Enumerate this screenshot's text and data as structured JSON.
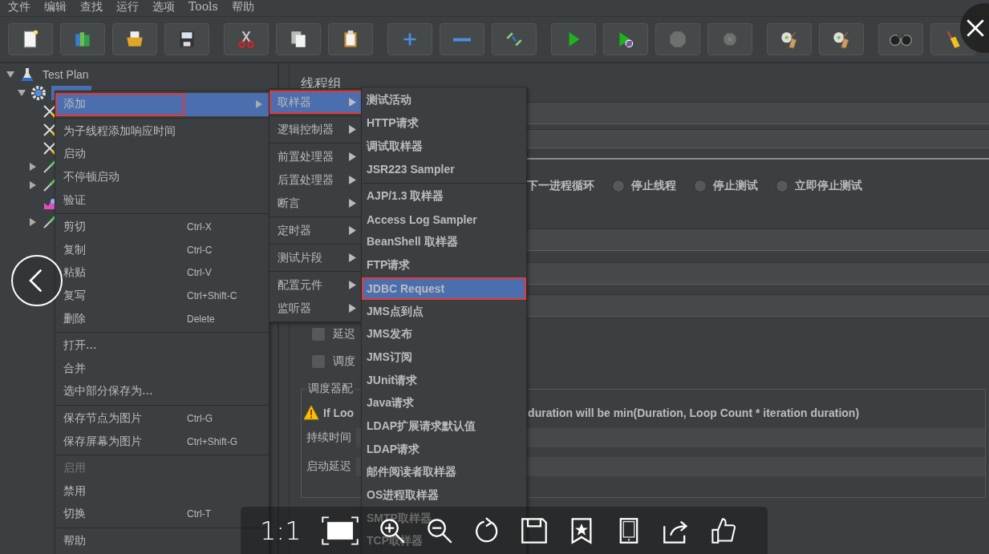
{
  "menu_bar": [
    "文件",
    "编辑",
    "查找",
    "运行",
    "选项",
    "Tools",
    "帮助"
  ],
  "toolbar": [
    [
      {
        "kind": "new",
        "disabled": false
      },
      {
        "kind": "templates",
        "disabled": false
      },
      {
        "kind": "open",
        "disabled": false
      },
      {
        "kind": "save",
        "disabled": false
      }
    ],
    [
      {
        "kind": "cut",
        "disabled": false
      },
      {
        "kind": "copy",
        "disabled": false
      },
      {
        "kind": "paste",
        "disabled": false
      }
    ],
    [
      {
        "kind": "expand",
        "disabled": false
      },
      {
        "kind": "collapse",
        "disabled": false
      },
      {
        "kind": "toggle",
        "disabled": false
      }
    ],
    [
      {
        "kind": "start",
        "disabled": false
      },
      {
        "kind": "start-no-timers",
        "disabled": false
      },
      {
        "kind": "stop",
        "disabled": true
      },
      {
        "kind": "shutdown",
        "disabled": true
      }
    ],
    [
      {
        "kind": "clear",
        "disabled": false
      },
      {
        "kind": "clear-all",
        "disabled": false
      }
    ],
    [
      {
        "kind": "search",
        "disabled": false
      },
      {
        "kind": "reset",
        "disabled": false
      }
    ]
  ],
  "tree": [
    {
      "label": "Test Plan",
      "kind": "plan",
      "expanded": true,
      "selected": false,
      "children": [
        {
          "kind": "thread-group",
          "expanded": true,
          "selected": true,
          "children": [
            {
              "kind": "config"
            },
            {
              "kind": "config"
            },
            {
              "kind": "config"
            },
            {
              "kind": "sampler",
              "expanded": false
            },
            {
              "kind": "sampler",
              "expanded": false
            },
            {
              "kind": "listener"
            },
            {
              "kind": "sampler",
              "expanded": false
            }
          ]
        }
      ]
    }
  ],
  "panel": {
    "title": "线程组",
    "error_actions": [
      {
        "label": "下一进程循环",
        "selected": false
      },
      {
        "label": "停止线程",
        "selected": false
      },
      {
        "label": "停止测试",
        "selected": false
      },
      {
        "label": "立即停止测试",
        "selected": false
      }
    ],
    "checkboxes": [
      {
        "label": "延迟",
        "checked": false
      },
      {
        "label": "调度",
        "checked": false
      }
    ],
    "scheduler": {
      "legend": "调度器配",
      "warning_start": "If Loo",
      "warning_end": "duration will be min(Duration, Loop Count * iteration duration)",
      "fields": [
        "持续时间",
        "启动延迟"
      ]
    }
  },
  "context_menu": {
    "groups": [
      [
        {
          "label": "添加",
          "submenu": true,
          "selected": true,
          "disabled": false,
          "marked": true
        }
      ],
      [
        {
          "label": "为子线程添加响应时间",
          "selected": false,
          "disabled": false,
          "marked": false
        },
        {
          "label": "启动",
          "selected": false,
          "disabled": false,
          "marked": false
        },
        {
          "label": "不停顿启动",
          "selected": false,
          "disabled": false,
          "marked": false
        },
        {
          "label": "验证",
          "selected": false,
          "disabled": false,
          "marked": false
        }
      ],
      [
        {
          "label": "剪切",
          "shortcut": "Ctrl-X",
          "selected": false,
          "disabled": false,
          "marked": false
        },
        {
          "label": "复制",
          "shortcut": "Ctrl-C",
          "selected": false,
          "disabled": false,
          "marked": false
        },
        {
          "label": "粘贴",
          "shortcut": "Ctrl-V",
          "selected": false,
          "disabled": false,
          "marked": false
        },
        {
          "label": "复写",
          "shortcut": "Ctrl+Shift-C",
          "selected": false,
          "disabled": false,
          "marked": false
        },
        {
          "label": "删除",
          "shortcut": "Delete",
          "selected": false,
          "disabled": false,
          "marked": false
        }
      ],
      [
        {
          "label": "打开...",
          "selected": false,
          "disabled": false,
          "marked": false
        },
        {
          "label": "合并",
          "selected": false,
          "disabled": false,
          "marked": false
        },
        {
          "label": "选中部分保存为...",
          "selected": false,
          "disabled": false,
          "marked": false
        }
      ],
      [
        {
          "label": "保存节点为图片",
          "shortcut": "Ctrl-G",
          "selected": false,
          "disabled": false,
          "marked": false
        },
        {
          "label": "保存屏幕为图片",
          "shortcut": "Ctrl+Shift-G",
          "selected": false,
          "disabled": false,
          "marked": false
        }
      ],
      [
        {
          "label": "启用",
          "selected": false,
          "disabled": true,
          "marked": false
        },
        {
          "label": "禁用",
          "selected": false,
          "disabled": false,
          "marked": false
        },
        {
          "label": "切换",
          "shortcut": "Ctrl-T",
          "selected": false,
          "disabled": false,
          "marked": false
        }
      ],
      [
        {
          "label": "帮助",
          "selected": false,
          "disabled": false,
          "marked": false
        }
      ]
    ]
  },
  "add_menu": {
    "groups": [
      [
        {
          "label": "取样器",
          "selected": true,
          "marked": true
        }
      ],
      [
        {
          "label": "逻辑控制器",
          "selected": false,
          "marked": false
        }
      ],
      [
        {
          "label": "前置处理器",
          "selected": false,
          "marked": false
        },
        {
          "label": "后置处理器",
          "selected": false,
          "marked": false
        },
        {
          "label": "断言",
          "selected": false,
          "marked": false
        }
      ],
      [
        {
          "label": "定时器",
          "selected": false,
          "marked": false
        }
      ],
      [
        {
          "label": "测试片段",
          "selected": false,
          "marked": false
        }
      ],
      [
        {
          "label": "配置元件",
          "selected": false,
          "marked": false
        },
        {
          "label": "监听器",
          "selected": false,
          "marked": false
        }
      ]
    ]
  },
  "sampler_menu": {
    "groups": [
      [
        {
          "label": "测试活动",
          "selected": false,
          "marked": false
        },
        {
          "label": "HTTP请求",
          "selected": false,
          "marked": false
        },
        {
          "label": "调试取样器",
          "selected": false,
          "marked": false
        },
        {
          "label": "JSR223 Sampler",
          "selected": false,
          "marked": false
        }
      ],
      [
        {
          "label": "AJP/1.3 取样器",
          "selected": false,
          "marked": false
        },
        {
          "label": "Access Log Sampler",
          "selected": false,
          "marked": false
        },
        {
          "label": "BeanShell 取样器",
          "selected": false,
          "marked": false
        },
        {
          "label": "FTP请求",
          "selected": false,
          "marked": false
        },
        {
          "label": "JDBC Request",
          "selected": true,
          "marked": true
        },
        {
          "label": "JMS点到点",
          "selected": false,
          "marked": false
        },
        {
          "label": "JMS发布",
          "selected": false,
          "marked": false
        },
        {
          "label": "JMS订阅",
          "selected": false,
          "marked": false
        },
        {
          "label": "JUnit请求",
          "selected": false,
          "marked": false
        },
        {
          "label": "Java请求",
          "selected": false,
          "marked": false
        },
        {
          "label": "LDAP扩展请求默认值",
          "selected": false,
          "marked": false
        },
        {
          "label": "LDAP请求",
          "selected": false,
          "marked": false
        },
        {
          "label": "邮件阅读者取样器",
          "selected": false,
          "marked": false
        },
        {
          "label": "OS进程取样器",
          "selected": false,
          "marked": false
        },
        {
          "label": "SMTP取样器",
          "selected": false,
          "marked": false
        },
        {
          "label": "TCP取样器",
          "selected": false,
          "marked": false
        }
      ]
    ]
  },
  "viewer": {
    "zoom_label": "1:1"
  }
}
